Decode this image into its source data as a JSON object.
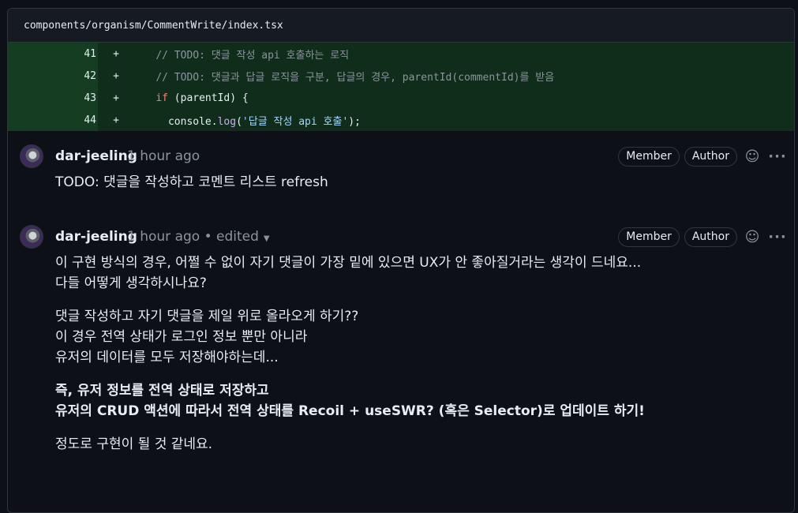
{
  "file": {
    "path": "components/organism/CommentWrite/index.tsx"
  },
  "diff_lines": [
    {
      "num": "41",
      "sign": "+",
      "indent": "    ",
      "parts": [
        {
          "t": "// TODO: 댓글 작성 api 호출하는 로직",
          "c": "comment"
        }
      ]
    },
    {
      "num": "42",
      "sign": "+",
      "indent": "    ",
      "parts": [
        {
          "t": "// TODO: 댓글과 답글 로직을 구분, 답글의 경우, parentId(commentId)를 받음",
          "c": "comment"
        }
      ]
    },
    {
      "num": "43",
      "sign": "+",
      "indent": "    ",
      "parts": [
        {
          "t": "if",
          "c": "kw"
        },
        {
          "t": " (parentId) {",
          "c": ""
        }
      ]
    },
    {
      "num": "44",
      "sign": "+",
      "indent": "      ",
      "parts": [
        {
          "t": "console",
          "c": ""
        },
        {
          "t": ".",
          "c": ""
        },
        {
          "t": "log",
          "c": "fn"
        },
        {
          "t": "(",
          "c": ""
        },
        {
          "t": "'답글 작성 api 호출'",
          "c": "str"
        },
        {
          "t": ");",
          "c": ""
        }
      ]
    }
  ],
  "comments": [
    {
      "author": "dar-jeeling",
      "time": "1 hour ago",
      "edited": "",
      "badges": [
        "Member",
        "Author"
      ],
      "body_paragraphs": [
        {
          "lines": [
            "TODO: 댓글을 작성하고 코멘트 리스트 refresh"
          ],
          "bold": false
        }
      ]
    },
    {
      "author": "dar-jeeling",
      "time": "1 hour ago",
      "edited": "• edited",
      "badges": [
        "Member",
        "Author"
      ],
      "body_paragraphs": [
        {
          "lines": [
            "이 구현 방식의 경우, 어쩔 수 없이 자기 댓글이 가장 밑에 있으면 UX가 안 좋아질거라는 생각이 드네요...",
            "다들 어떻게 생각하시나요?"
          ],
          "bold": false
        },
        {
          "lines": [
            "댓글 작성하고 자기 댓글을 제일 위로 올라오게 하기??",
            "이 경우 전역 상태가 로그인 정보 뿐만 아니라",
            "유저의 데이터를 모두 저장해야하는데..."
          ],
          "bold": false
        },
        {
          "lines": [
            "즉, 유저 정보를 전역 상태로 저장하고",
            "유저의 CRUD 액션에 따라서 전역 상태를 Recoil + useSWR? (혹은 Selector)로 업데이트 하기!"
          ],
          "bold": true
        },
        {
          "lines": [
            "정도로 구현이 될 것 같네요."
          ],
          "bold": false
        }
      ]
    }
  ],
  "icons": {
    "emoji": "smiley-icon",
    "more": "kebab-icon"
  },
  "colors": {
    "diff_add_bg": "#0f2d1a",
    "badge_border": "#30363d",
    "muted": "#8b949e"
  }
}
